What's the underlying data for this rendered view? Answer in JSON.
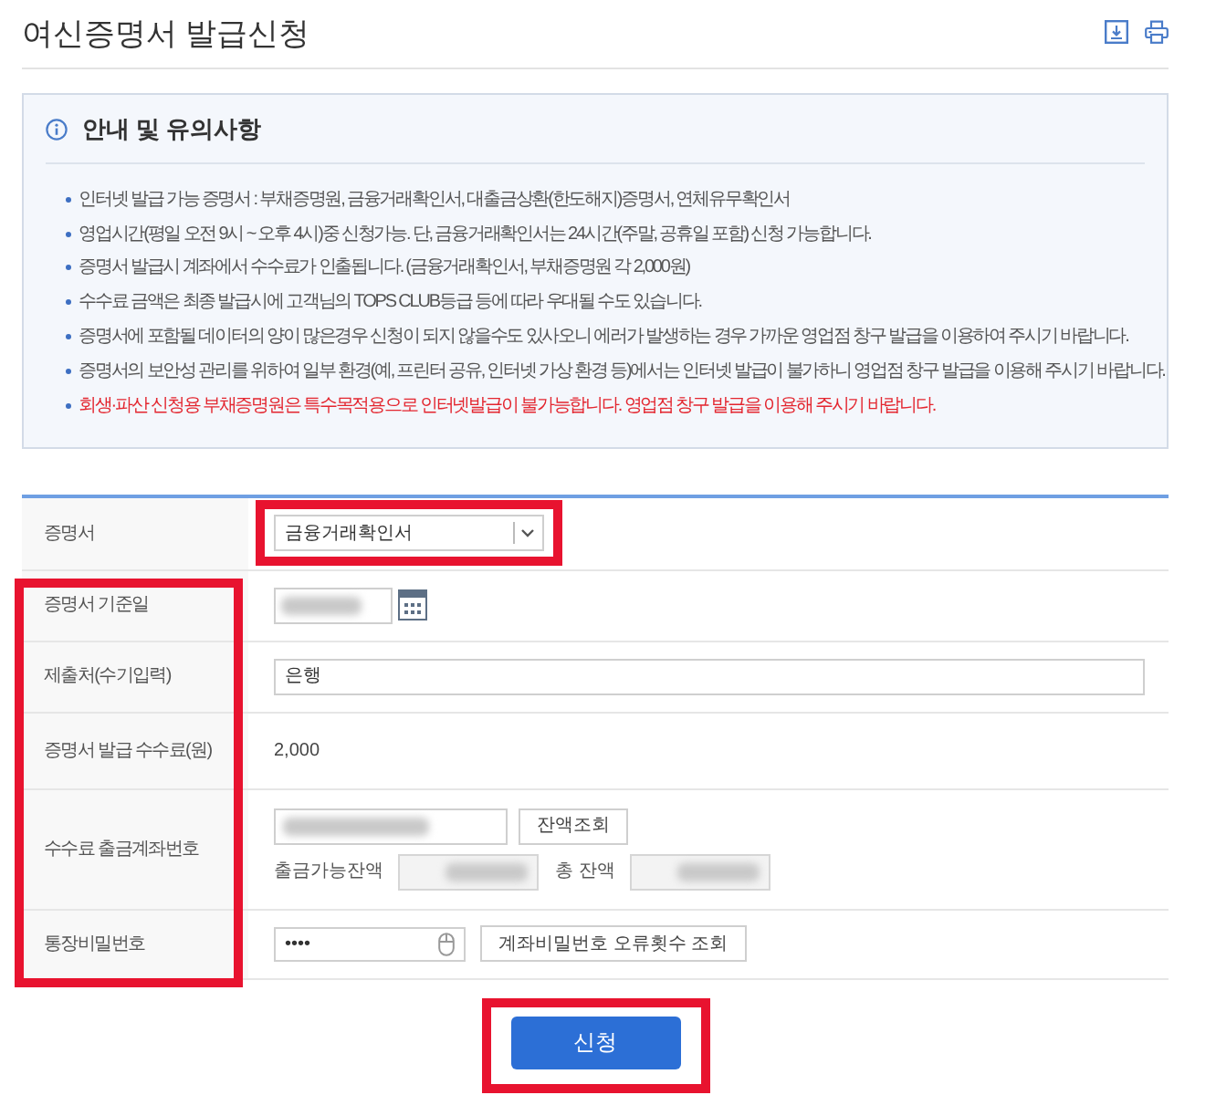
{
  "header": {
    "title": "여신증명서 발급신청"
  },
  "notice": {
    "title": "안내 및 유의사항",
    "items": [
      {
        "text": "인터넷 발급 가능 증명서 : 부채증명원, 금융거래확인서, 대출금상환(한도해지)증명서, 연체유무확인서",
        "warning": false
      },
      {
        "text": "영업시간(평일 오전 9시 ~ 오후 4시)중 신청가능. 단, 금융거래확인서는 24시간(주말, 공휴일 포함) 신청 가능합니다.",
        "warning": false
      },
      {
        "text": "증명서 발급시 계좌에서 수수료가 인출됩니다. (금융거래확인서, 부채증명원 각 2,000원)",
        "warning": false
      },
      {
        "text": "수수료 금액은 최종 발급시에 고객님의 TOPS CLUB등급 등에 따라 우대될 수도 있습니다.",
        "warning": false
      },
      {
        "text": "증명서에 포함될 데이터의 양이 많은경우 신청이 되지 않을수도 있사오니 에러가 발생하는 경우 가까운 영업점 창구 발급을 이용하여 주시기 바랍니다.",
        "warning": false
      },
      {
        "text": "증명서의 보안성 관리를 위하여 일부 환경(예, 프린터 공유, 인터넷 가상 환경 등)에서는 인터넷 발급이 불가하니 영업점 창구 발급을 이용해 주시기 바랍니다.",
        "warning": false
      },
      {
        "text": "회생·파산 신청용 부채증명원은 특수목적용으로 인터넷발급이 불가능합니다. 영업점 창구 발급을 이용해 주시기 바랍니다.",
        "warning": true
      }
    ]
  },
  "form": {
    "rows": [
      {
        "label": "증명서",
        "kind": "select",
        "value": "금융거래확인서",
        "highlighted": false,
        "field_highlighted": true
      },
      {
        "label": "증명서 기준일",
        "kind": "date",
        "redacted": true,
        "highlighted": true
      },
      {
        "label": "제출처(수기입력)",
        "kind": "text",
        "value": "은행",
        "highlighted": true
      },
      {
        "label": "증명서 발급 수수료(원)",
        "kind": "static",
        "value": "2,000",
        "highlighted": true
      },
      {
        "label": "수수료 출금계좌번호",
        "kind": "account",
        "redacted": true,
        "button": "잔액조회",
        "balances": [
          {
            "label": "출금가능잔액",
            "redacted": true
          },
          {
            "label": "총 잔액",
            "redacted": true
          }
        ],
        "highlighted": true
      },
      {
        "label": "통장비밀번호",
        "kind": "password",
        "value": "••••",
        "button": "계좌비밀번호 오류횟수 조회",
        "highlighted": true
      }
    ]
  },
  "submit": {
    "label": "신청",
    "highlighted": true
  }
}
